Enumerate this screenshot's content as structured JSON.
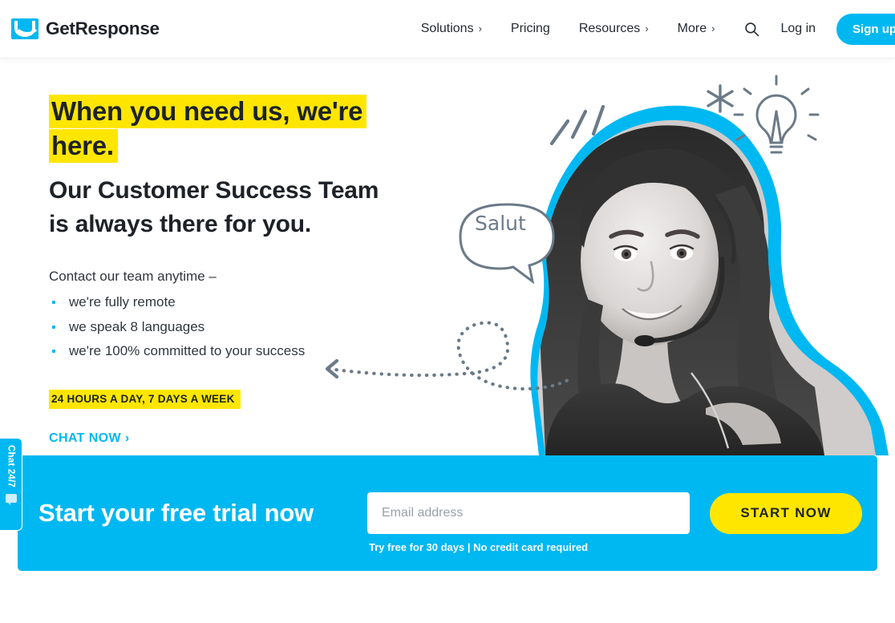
{
  "header": {
    "logo": {
      "text": "GetResponse",
      "icon": "envelope-icon"
    },
    "nav": [
      {
        "label": "Solutions",
        "caret": "›",
        "has_caret": true
      },
      {
        "label": "Pricing",
        "caret": "",
        "has_caret": false
      },
      {
        "label": "Resources",
        "caret": "›",
        "has_caret": true
      },
      {
        "label": "More",
        "caret": "›",
        "has_caret": true
      }
    ],
    "search_icon": "search-icon",
    "login_label": "Log in",
    "signup_label": "Sign up free"
  },
  "hero": {
    "headline_highlight_1": "When you need us, we're",
    "headline_highlight_2": "here.",
    "subheadline_line_1": "Our Customer Success Team",
    "subheadline_line_2": "is always there for you.",
    "lead": "Contact our team anytime –",
    "bullets": [
      "we're fully remote",
      "we speak 8 languages",
      "we're 100% committed to your success"
    ],
    "badge": "24 HOURS A DAY, 7 DAYS A WEEK",
    "chat_now": "CHAT NOW ›",
    "art": {
      "speech_bubble_text": "Salut",
      "photo_alt": "smiling-support-agent-with-headset",
      "doodles": [
        "sparkle-icon",
        "lightbulb-icon",
        "motion-lines",
        "dotted-arrow"
      ]
    }
  },
  "cta": {
    "title": "Start your free trial now",
    "email_placeholder": "Email address",
    "email_value": "",
    "note": "Try free for 30 days | No credit card required",
    "button_label": "START NOW"
  },
  "chat_widget": {
    "label": "Chat 24/7",
    "icon": "chat-bubble-icon"
  },
  "colors": {
    "brand_blue": "#00b8f1",
    "highlight_yellow": "#ffe600",
    "text_dark": "#1d2228",
    "body_text": "#2f373d",
    "doodle_gray": "#6b7a88"
  }
}
